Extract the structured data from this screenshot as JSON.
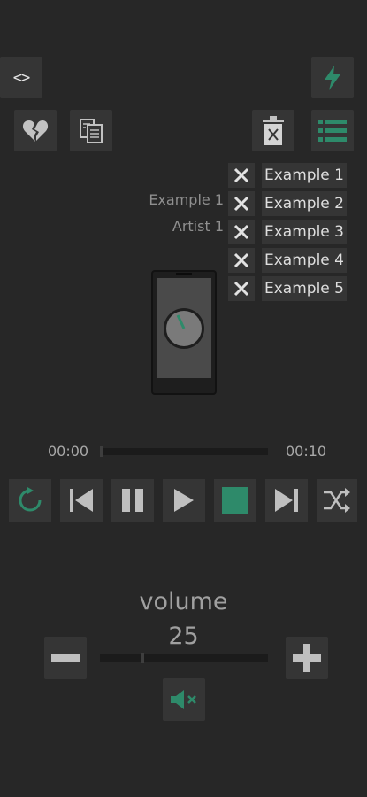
{
  "colors": {
    "background": "#272727",
    "button": "#353535",
    "accent": "#2e8a6a",
    "icon": "#bfbfbf"
  },
  "top": {
    "code_icon": "code-angle-brackets-icon",
    "lightning_icon": "lightning-icon",
    "broken_heart_icon": "broken-heart-icon",
    "copy_icon": "copy-docs-icon",
    "trash_icon": "trash-icon",
    "list_icon": "playlist-icon"
  },
  "track": {
    "title": "Example 1",
    "artist": "Artist 1"
  },
  "playlist": [
    {
      "name": "Example 1"
    },
    {
      "name": "Example 2"
    },
    {
      "name": "Example 3"
    },
    {
      "name": "Example 4"
    },
    {
      "name": "Example 5"
    }
  ],
  "progress": {
    "current": "00:00",
    "total": "00:10",
    "fraction": 0.0
  },
  "controls": {
    "repeat": "repeat-icon",
    "prev": "skip-previous-icon",
    "pause": "pause-icon",
    "play": "play-icon",
    "stop": "stop-icon",
    "next": "skip-next-icon",
    "shuffle": "shuffle-icon"
  },
  "volume": {
    "label": "volume",
    "value": "25",
    "level_fraction": 0.25
  }
}
